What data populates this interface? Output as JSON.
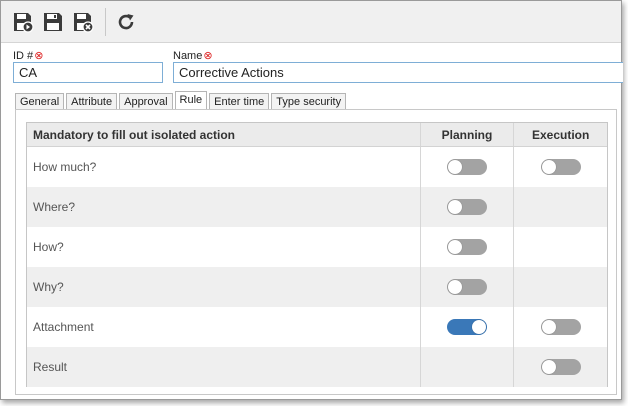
{
  "toolbar": {
    "buttons": [
      {
        "icon": "save-new-icon"
      },
      {
        "icon": "save-icon"
      },
      {
        "icon": "save-close-icon"
      },
      {
        "icon": "refresh-icon"
      }
    ]
  },
  "fields": {
    "id_label": "ID #",
    "id_value": "CA",
    "name_label": "Name",
    "name_value": "Corrective Actions",
    "required_mark": "⊗"
  },
  "tabs": [
    {
      "label": "General",
      "active": false
    },
    {
      "label": "Attribute",
      "active": false
    },
    {
      "label": "Approval",
      "active": false
    },
    {
      "label": "Rule",
      "active": true
    },
    {
      "label": "Enter time",
      "active": false
    },
    {
      "label": "Type security",
      "active": false
    }
  ],
  "grid": {
    "header": {
      "col1": "Mandatory to fill out isolated action",
      "col2": "Planning",
      "col3": "Execution"
    },
    "rows": [
      {
        "label": "How much?",
        "planning": false,
        "execution": false
      },
      {
        "label": "Where?",
        "planning": false,
        "execution": null
      },
      {
        "label": "How?",
        "planning": false,
        "execution": null
      },
      {
        "label": "Why?",
        "planning": false,
        "execution": null
      },
      {
        "label": "Attachment",
        "planning": true,
        "execution": false
      },
      {
        "label": "Result",
        "planning": null,
        "execution": false
      }
    ]
  },
  "colors": {
    "toggle_on": "#3a78b8",
    "toggle_off": "#a3a3a3",
    "input_border": "#7eaed6"
  }
}
